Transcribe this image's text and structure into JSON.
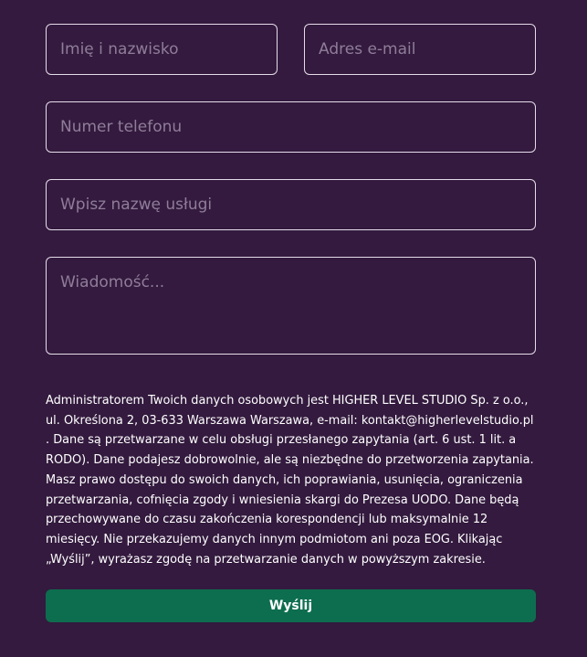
{
  "form": {
    "name_placeholder": "Imię i nazwisko",
    "email_placeholder": "Adres e-mail",
    "phone_placeholder": "Numer telefonu",
    "service_placeholder": "Wpisz nazwę usługi",
    "message_placeholder": "Wiadomość...",
    "consent_text": "Administratorem Twoich danych osobowych jest HIGHER LEVEL STUDIO Sp. z o.o., ul. Określona 2, 03-633 Warszawa Warszawa, e-mail: kontakt@higherlevelstudio.pl . Dane są przetwarzane w celu obsługi przesłanego zapytania (art. 6 ust. 1 lit. a RODO). Dane podajesz dobrowolnie, ale są niezbędne do przetworzenia zapytania. Masz prawo dostępu do swoich danych, ich poprawiania, usunięcia, ograniczenia przetwarzania, cofnięcia zgody i wniesienia skargi do Prezesa UODO. Dane będą przechowywane do czasu zakończenia korespondencji lub maksymalnie 12 miesięcy. Nie przekazujemy danych innym podmiotom ani poza EOG. Klikając „Wyślij”, wyrażasz zgodę na przetwarzanie danych w powyższym zakresie.",
    "submit_label": "Wyślij"
  },
  "colors": {
    "background": "#331a3e",
    "field_border": "#e6dcea",
    "placeholder": "#8f7d99",
    "button": "#0d6e4f",
    "text": "#ffffff"
  }
}
